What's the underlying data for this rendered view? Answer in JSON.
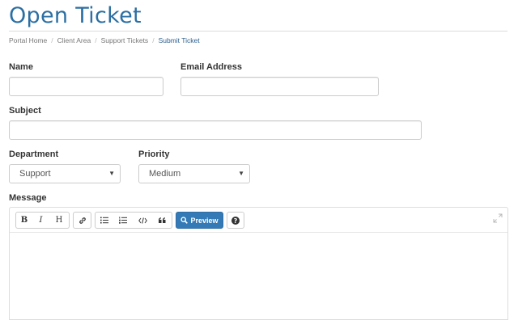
{
  "page": {
    "title": "Open Ticket"
  },
  "breadcrumb": [
    {
      "label": "Portal Home"
    },
    {
      "label": "Client Area"
    },
    {
      "label": "Support Tickets"
    },
    {
      "label": "Submit Ticket"
    }
  ],
  "form": {
    "name_label": "Name",
    "name_value": "",
    "email_label": "Email Address",
    "email_value": "",
    "subject_label": "Subject",
    "subject_value": "",
    "department_label": "Department",
    "department_value": "Support",
    "priority_label": "Priority",
    "priority_value": "Medium",
    "message_label": "Message"
  },
  "editor": {
    "bold_label": "B",
    "italic_label": "I",
    "heading_label": "H",
    "preview_label": "Preview",
    "message_value": ""
  },
  "colors": {
    "accent": "#337ab7",
    "title": "#2c6fa3"
  },
  "icons": [
    "bold-icon",
    "italic-icon",
    "heading-icon",
    "link-icon",
    "unordered-list-icon",
    "ordered-list-icon",
    "code-icon",
    "quote-icon",
    "search-icon",
    "help-icon",
    "expand-icon",
    "caret-down-icon"
  ]
}
